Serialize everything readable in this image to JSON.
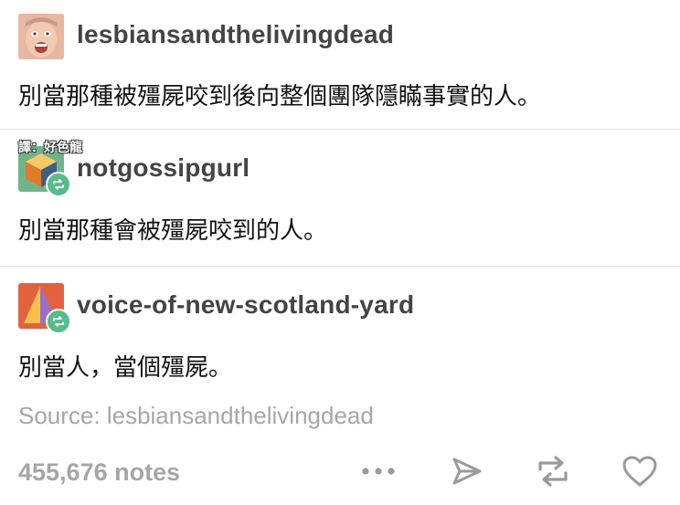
{
  "posts": [
    {
      "username": "lesbiansandthelivingdead",
      "text": "別當那種被殭屍咬到後向整個團隊隱瞞事實的人。",
      "is_reblog": false
    },
    {
      "username": "notgossipgurl",
      "text": "別當那種會被殭屍咬到的人。",
      "is_reblog": true,
      "overlay_label": "譯：好色龍"
    },
    {
      "username": "voice-of-new-scotland-yard",
      "text": "別當人，當個殭屍。",
      "is_reblog": true
    }
  ],
  "source": "Source: lesbiansandthelivingdead",
  "footer": {
    "notes": "455,676 notes",
    "actions": [
      "more-icon",
      "share-icon",
      "reblog-icon",
      "like-icon"
    ]
  },
  "colors": {
    "username": "#444444",
    "muted": "#a6a6a6",
    "reblog_green": "#56bc8a",
    "divider": "#e2e2e2"
  }
}
